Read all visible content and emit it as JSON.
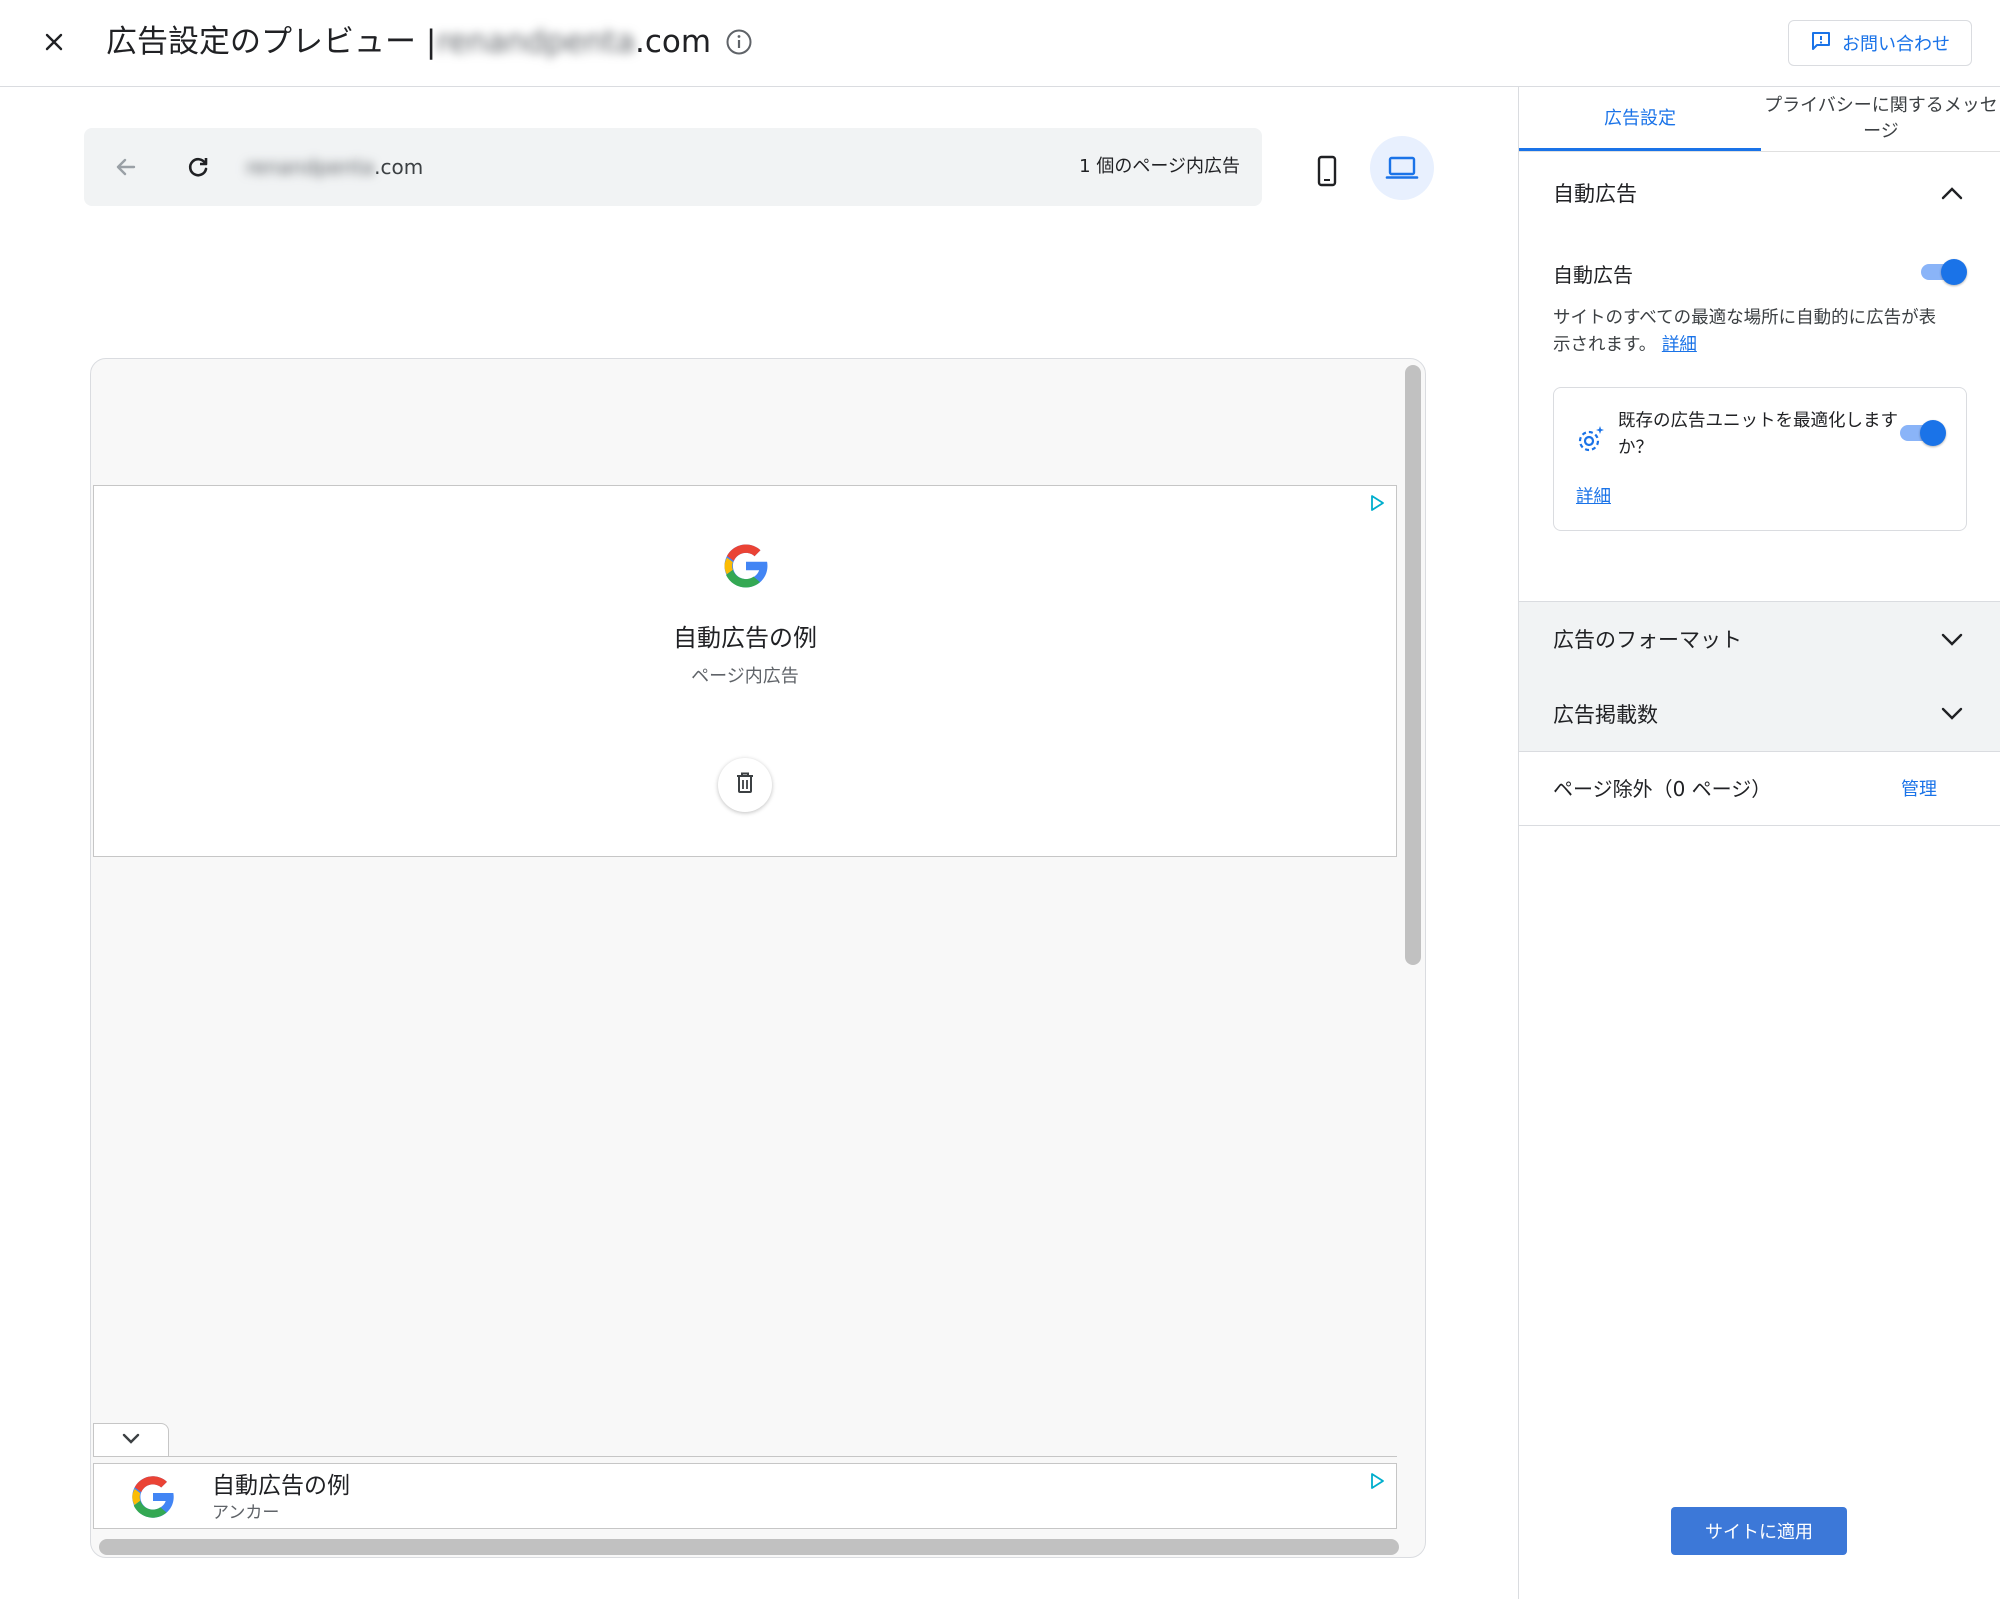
{
  "header": {
    "title_prefix": "広告設定のプレビュー | ",
    "domain_blurred": "renandpenta",
    "domain_suffix": ".com",
    "contact_label": "お問い合わせ"
  },
  "preview": {
    "url_blurred": "renandpenta",
    "url_suffix": ".com",
    "ad_count": "1 個のページ内広告",
    "inpage_ad": {
      "title": "自動広告の例",
      "subtitle": "ページ内広告"
    },
    "anchor_ad": {
      "title": "自動広告の例",
      "subtitle": "アンカー"
    }
  },
  "panel": {
    "tabs": [
      {
        "label": "広告設定"
      },
      {
        "label": "プライバシーに関するメッセージ"
      }
    ],
    "auto_ads_section": {
      "heading": "自動広告",
      "toggle_label": "自動広告",
      "toggle_on": true,
      "description": "サイトのすべての最適な場所に自動的に広告が表示されます。",
      "details_link": "詳細",
      "optimize_box": {
        "text": "既存の広告ユニットを最適化しますか？",
        "toggle_on": true,
        "details_link": "詳細"
      }
    },
    "formats_section": {
      "heading": "広告のフォーマット"
    },
    "load_section": {
      "heading": "広告掲載数"
    },
    "exclusions": {
      "label": "ページ除外（0 ページ）",
      "manage": "管理"
    },
    "apply_button": "サイトに適用"
  },
  "colors": {
    "accent": "#1a73e8",
    "apply_button": "#3c78d8",
    "toggle_track": "#8ab4f8"
  }
}
